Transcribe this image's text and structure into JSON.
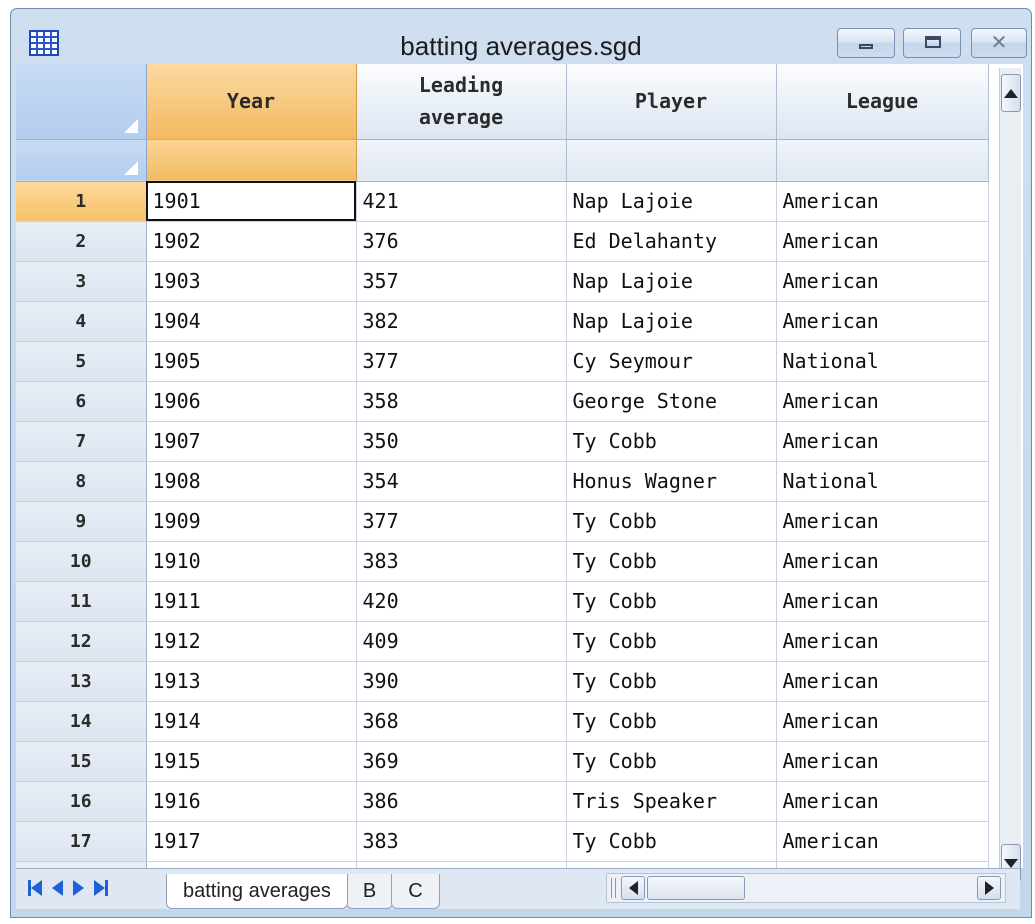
{
  "window": {
    "title": "batting averages.sgd",
    "icon": "grid-icon",
    "controls": {
      "minimize": "minimize",
      "maximize": "maximize",
      "close": "✕"
    }
  },
  "columns": [
    {
      "label": "Year",
      "selected": true
    },
    {
      "label_line1": "Leading",
      "label_line2": "average",
      "selected": false
    },
    {
      "label": "Player",
      "selected": false
    },
    {
      "label": "League",
      "selected": false
    }
  ],
  "rows": [
    {
      "n": "1",
      "year": "1901",
      "avg": "421",
      "player": "Nap Lajoie",
      "league": "American"
    },
    {
      "n": "2",
      "year": "1902",
      "avg": "376",
      "player": "Ed Delahanty",
      "league": "American"
    },
    {
      "n": "3",
      "year": "1903",
      "avg": "357",
      "player": "Nap Lajoie",
      "league": "American"
    },
    {
      "n": "4",
      "year": "1904",
      "avg": "382",
      "player": "Nap Lajoie",
      "league": "American"
    },
    {
      "n": "5",
      "year": "1905",
      "avg": "377",
      "player": "Cy Seymour",
      "league": "National"
    },
    {
      "n": "6",
      "year": "1906",
      "avg": "358",
      "player": "George Stone",
      "league": "American"
    },
    {
      "n": "7",
      "year": "1907",
      "avg": "350",
      "player": "Ty Cobb",
      "league": "American"
    },
    {
      "n": "8",
      "year": "1908",
      "avg": "354",
      "player": "Honus Wagner",
      "league": "National"
    },
    {
      "n": "9",
      "year": "1909",
      "avg": "377",
      "player": "Ty Cobb",
      "league": "American"
    },
    {
      "n": "10",
      "year": "1910",
      "avg": "383",
      "player": "Ty Cobb",
      "league": "American"
    },
    {
      "n": "11",
      "year": "1911",
      "avg": "420",
      "player": "Ty Cobb",
      "league": "American"
    },
    {
      "n": "12",
      "year": "1912",
      "avg": "409",
      "player": "Ty Cobb",
      "league": "American"
    },
    {
      "n": "13",
      "year": "1913",
      "avg": "390",
      "player": "Ty Cobb",
      "league": "American"
    },
    {
      "n": "14",
      "year": "1914",
      "avg": "368",
      "player": "Ty Cobb",
      "league": "American"
    },
    {
      "n": "15",
      "year": "1915",
      "avg": "369",
      "player": "Ty Cobb",
      "league": "American"
    },
    {
      "n": "16",
      "year": "1916",
      "avg": "386",
      "player": "Tris Speaker",
      "league": "American"
    },
    {
      "n": "17",
      "year": "1917",
      "avg": "383",
      "player": "Ty Cobb",
      "league": "American"
    }
  ],
  "active_cell": {
    "row": "1",
    "column": "Year"
  },
  "tabs": [
    {
      "label": "batting averages",
      "active": true
    },
    {
      "label": "B",
      "active": false
    },
    {
      "label": "C",
      "active": false
    }
  ],
  "colors": {
    "selected_header": "#f2b960",
    "header_blue": "#b3cdee",
    "nav_blue": "#1e63d6"
  }
}
